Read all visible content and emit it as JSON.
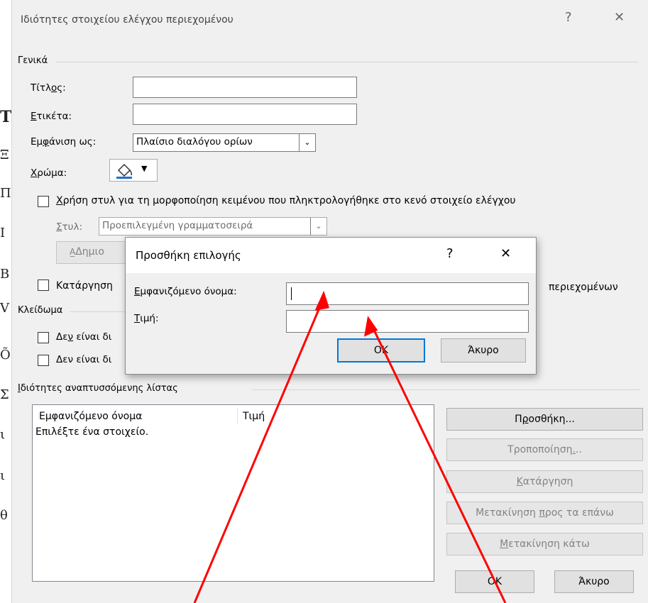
{
  "main": {
    "title": "Ιδιότητες στοιχείου ελέγχου περιεχομένου",
    "help_glyph": "?",
    "close_glyph": "✕",
    "general": {
      "section_title": "Γενικά",
      "title_label_pre": "Τίτλ",
      "title_label_u": "ο",
      "title_label_post": "ς:",
      "title_value": "",
      "tag_label_u": "Ε",
      "tag_label_post": "τικέτα:",
      "tag_value": "",
      "show_as_label_pre": "Εμ",
      "show_as_label_u": "φ",
      "show_as_label_post": "άνιση ως:",
      "show_as_value": "Πλαίσιο διαλόγου ορίων",
      "color_label_u": "Χ",
      "color_label_post": "ρώμα:",
      "use_style_u": "Χ",
      "use_style_post": "ρήση στυλ για τη μορφοποίηση κειμένου που πληκτρολογήθηκε στο κενό στοιχείο ελέγχου",
      "style_label_u": "Σ",
      "style_label_post": "τυλ:",
      "style_value": "Προεπιλεγμένη γραμματοσειρά",
      "new_style_button": "Δημιο",
      "remove_label_left": "Κατάργηση",
      "remove_label_right": "περιεχομένων"
    },
    "locking": {
      "section_title": "Κλείδωμα",
      "not_deletable_pre": "Δε",
      "not_deletable_u": "ν",
      "not_deletable_post": " είναι δι",
      "not_editable": "Δεν είναι δι"
    },
    "dropdown": {
      "section_title_u": "Ι",
      "section_title_post": "διότητες αναπτυσσόμενης λίστας",
      "columns": [
        "Εμφανιζόμενο όνομα",
        "Τιμή"
      ],
      "placeholder": "Επιλέξτε ένα στοιχείο."
    },
    "buttons": {
      "add_pre": "Π",
      "add_u": "ρ",
      "add_post": "οσθήκη...",
      "modify_pre": "Τροποποίηση",
      "modify_u": ".",
      "modify_post": "..",
      "remove_u": "Κ",
      "remove_post": "ατάργηση",
      "move_up_pre": "Μ",
      "move_up_mid": "ετακίνηση ",
      "move_up_u": "π",
      "move_up_post": "ρος τα επάνω",
      "move_down_u": "Μ",
      "move_down_post": "ετακίνηση κάτω",
      "ok": "OK",
      "cancel": "Άκυρο"
    }
  },
  "child": {
    "title": "Προσθήκη επιλογής",
    "help_glyph": "?",
    "close_glyph": "✕",
    "display_name_label_u": "Ε",
    "display_name_label_post": "μφανιζόμενο όνομα:",
    "display_name_value": "",
    "value_label_u": "Τ",
    "value_label_post": "ιμή:",
    "value_value": "",
    "ok": "OK",
    "cancel": "Άκυρο"
  },
  "colors": {
    "window_bg": "#f0f0f0",
    "arrow": "#ff0000",
    "focus_border": "#0078d7"
  },
  "left_fragments": [
    "T",
    "Ξ",
    "Π",
    "Ι",
    "Β",
    "Β",
    "V",
    "Õ",
    "Σ",
    "Σ",
    "ι",
    "θ",
    "θ"
  ]
}
